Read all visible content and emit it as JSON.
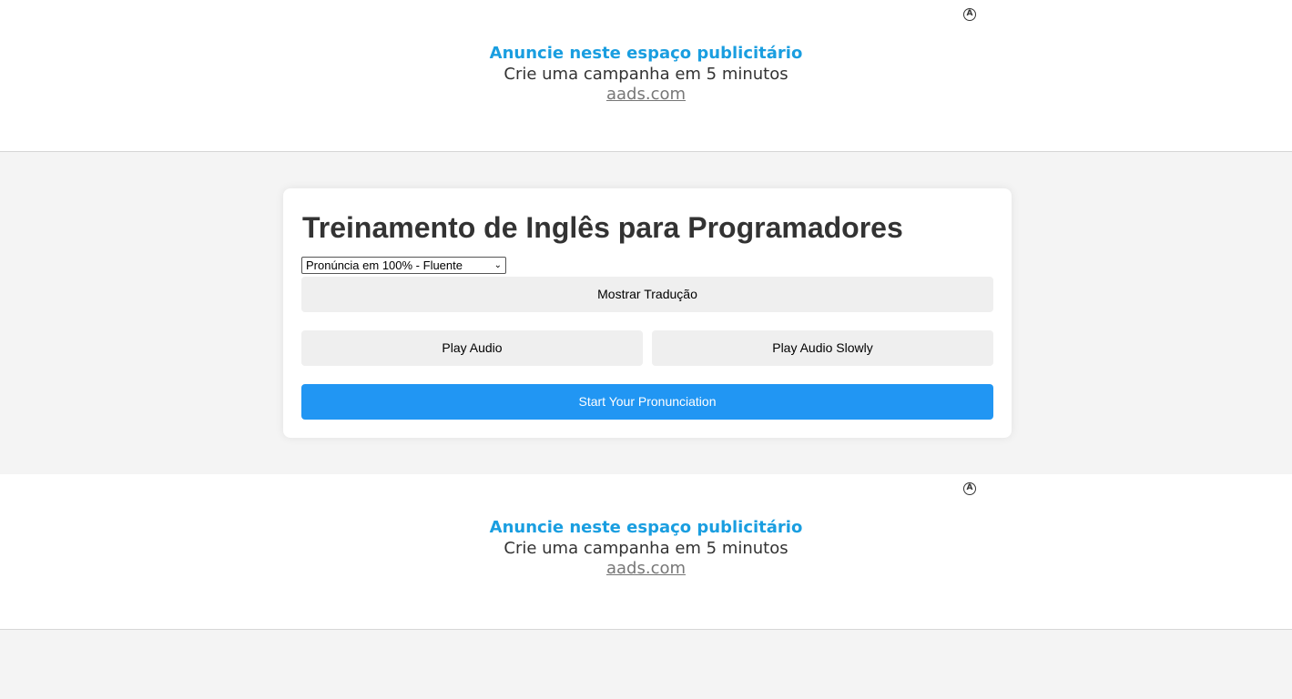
{
  "ads": [
    {
      "badge": "A",
      "headline": "Anuncie neste espaço publicitário",
      "subline": "Crie uma campanha em 5 minutos",
      "link": "aads.com"
    },
    {
      "badge": "A",
      "headline": "Anuncie neste espaço publicitário",
      "subline": "Crie uma campanha em 5 minutos",
      "link": "aads.com"
    }
  ],
  "card": {
    "title": "Treinamento de Inglês para Programadores",
    "level_select": {
      "selected": "Pronúncia em 100% - Fluente"
    },
    "buttons": {
      "translate": "Mostrar Tradução",
      "play": "Play Audio",
      "play_slowly": "Play Audio Slowly",
      "start": "Start Your Pronunciation"
    }
  },
  "colors": {
    "accent": "#2196f3",
    "ad_headline": "#1a9ee0",
    "page_bg": "#f4f4f4"
  }
}
